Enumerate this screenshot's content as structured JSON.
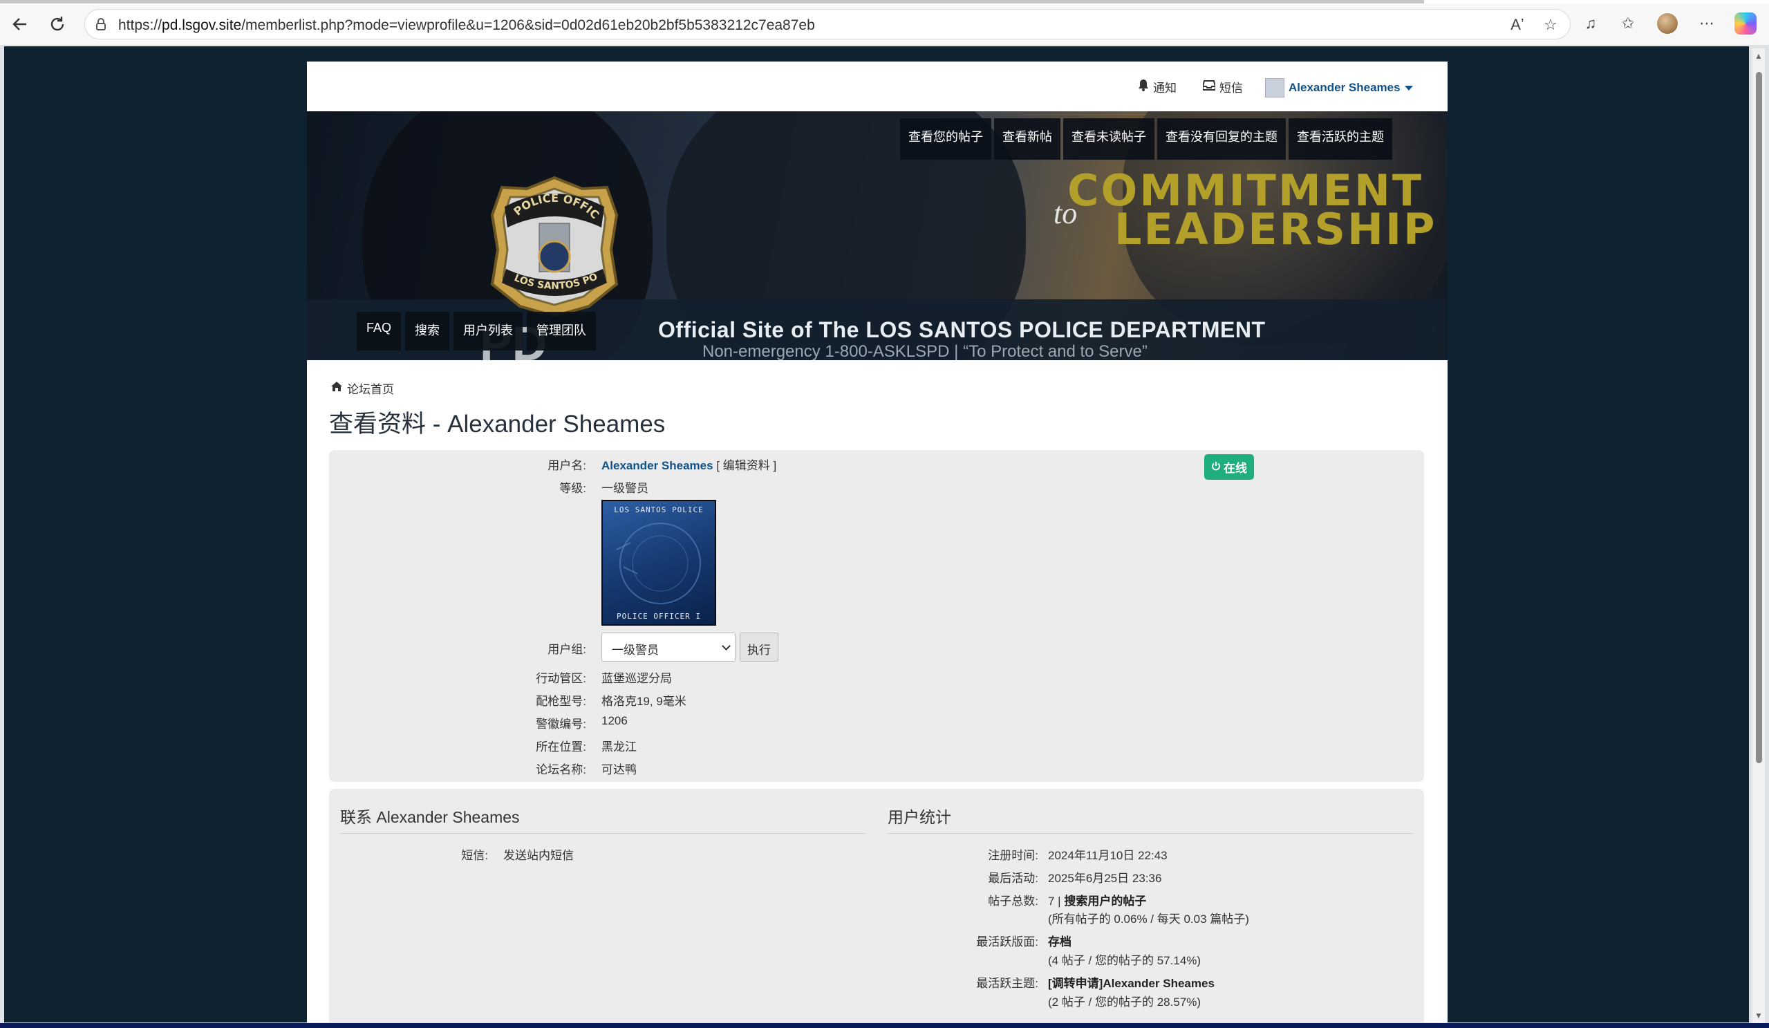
{
  "browser": {
    "url_prefix": "https://",
    "url_host": "pd.lsgov.site",
    "url_path": "/memberlist.php?mode=viewprofile&u=1206&sid=0d02d61eb20b2bf5b5383212c7ea87eb"
  },
  "userbar": {
    "notifications": "通知",
    "messages": "短信",
    "username": "Alexander Sheames"
  },
  "banner": {
    "commitment": "COMMITMENT",
    "to": "to",
    "leadership": "LEADERSHIP",
    "official_site": "Official Site of The LOS SANTOS POLICE DEPARTMENT",
    "nonemergency": "Non-emergency 1-800-ASKLSPD | “To Protect and to Serve”",
    "lspd_text": "PD",
    "badge_top": "POLICE OFFICER",
    "badge_bottom": "LOS SANTOS POLICE"
  },
  "topnav": [
    "查看您的帖子",
    "查看新帖",
    "查看未读帖子",
    "查看没有回复的主题",
    "查看活跃的主题"
  ],
  "botnav": [
    "FAQ",
    "搜索",
    "用户列表",
    "管理团队"
  ],
  "breadcrumb": "论坛首页",
  "page_title": "查看资料 - Alexander Sheames",
  "profile": {
    "username_label": "用户名:",
    "username": "Alexander Sheames",
    "edit_profile": "[ 编辑资料 ]",
    "online": "在线",
    "rank_label": "等级:",
    "rank": "一级警员",
    "rank_img_top": "LOS SANTOS POLICE",
    "rank_img_bottom": "POLICE OFFICER I",
    "group_label": "用户组:",
    "group_value": "一级警员",
    "execute": "执行",
    "division_label": "行动管区:",
    "division": "蓝堡巡逻分局",
    "weapon_label": "配枪型号:",
    "weapon": "格洛克19, 9毫米",
    "badge_label": "警徽编号:",
    "badge_no": "1206",
    "location_label": "所在位置:",
    "location": "黑龙江",
    "forum_name_label": "论坛名称:",
    "forum_name": "可达鸭"
  },
  "contact": {
    "title": "联系 Alexander Sheames",
    "pm_label": "短信:",
    "pm_value": "发送站内短信"
  },
  "stats": {
    "title": "用户统计",
    "joined_label": "注册时间:",
    "joined": "2024年11月10日 22:43",
    "last_active_label": "最后活动:",
    "last_active": "2025年6月25日 23:36",
    "posts_label": "帖子总数:",
    "posts_count": "7 | ",
    "posts_search": "搜索用户的帖子",
    "posts_detail": "(所有帖子的 0.06% / 每天 0.03 篇帖子)",
    "active_forum_label": "最活跃版面:",
    "active_forum": "存档",
    "active_forum_detail": "(4 帖子 / 您的帖子的 57.14%)",
    "active_topic_label": "最活跃主题:",
    "active_topic": "[调转申请]Alexander Sheames",
    "active_topic_detail": "(2 帖子 / 您的帖子的 28.57%)"
  }
}
